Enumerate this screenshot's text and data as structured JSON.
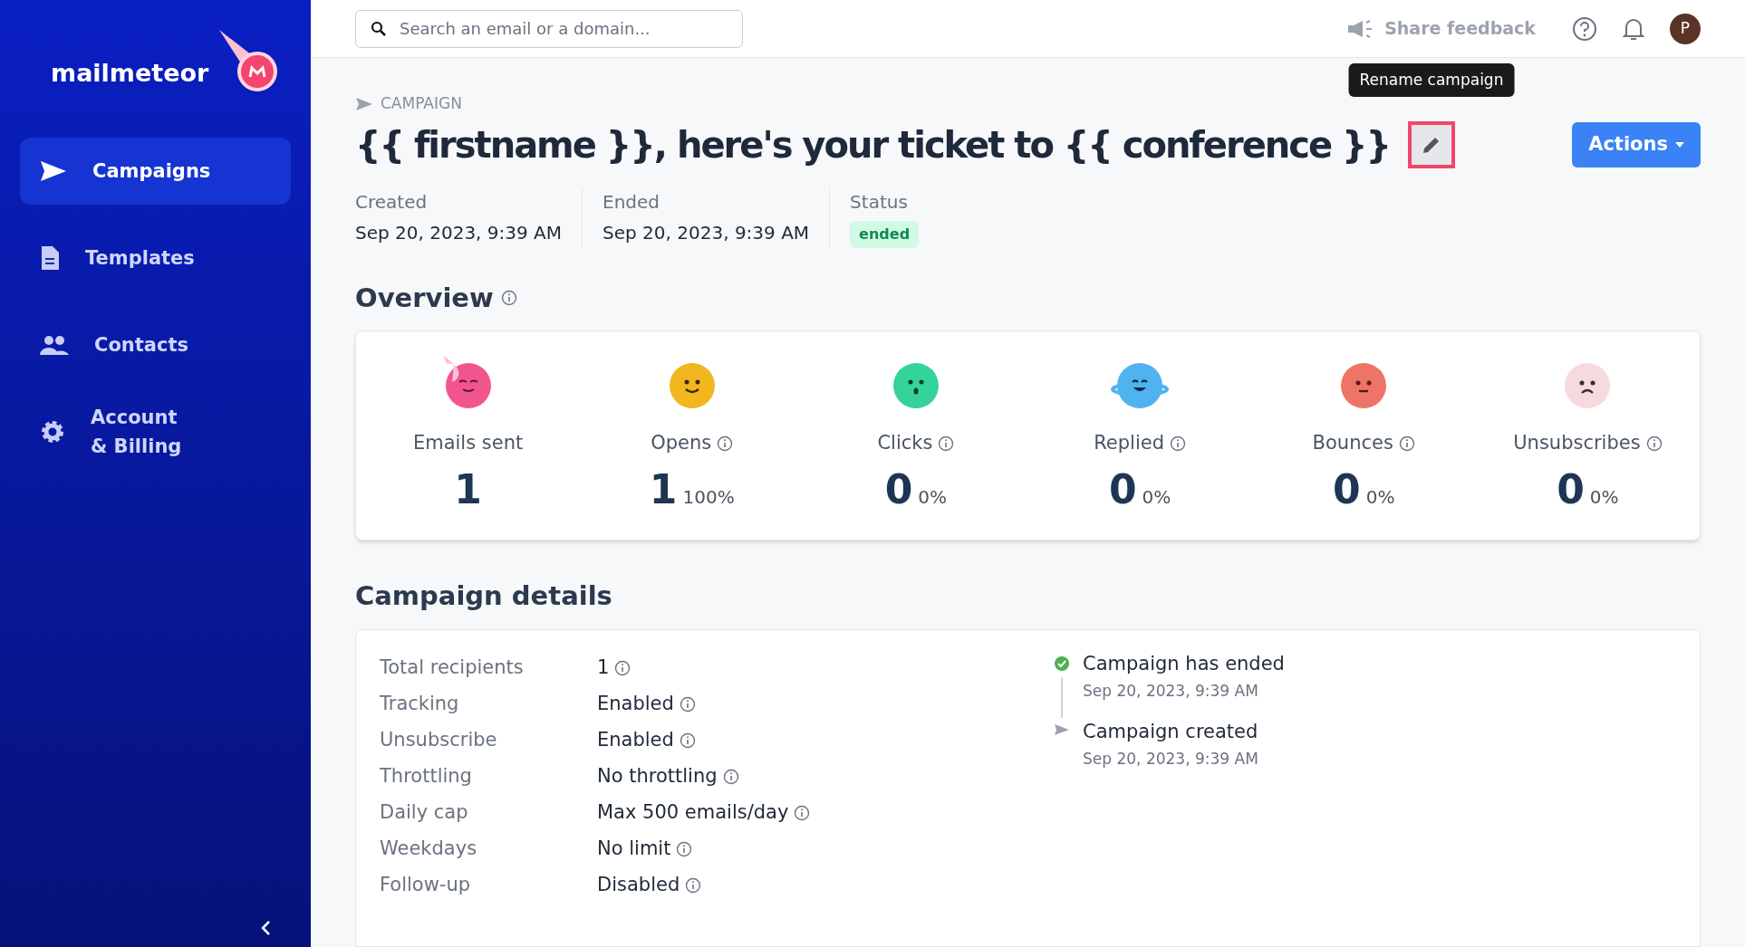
{
  "sidebar": {
    "logo": "mailmeteor",
    "items": [
      {
        "label": "Campaigns",
        "kind": "send",
        "selected": true
      },
      {
        "label": "Templates",
        "kind": "document",
        "selected": false
      },
      {
        "label": "Contacts",
        "kind": "people",
        "selected": false
      },
      {
        "label": "Account\n& Billing",
        "kind": "gear",
        "selected": false
      }
    ]
  },
  "header": {
    "search": {
      "placeholder": "Search an email or a domain..."
    },
    "feedback": "Share feedback",
    "avatar": "P"
  },
  "campaign": {
    "eyebrow": "CAMPAIGN",
    "title": "{{ firstname }}, here's your ticket to {{ conference }}",
    "tooltip": "Rename campaign",
    "actions": "Actions",
    "meta": [
      {
        "label": "Created",
        "value": "Sep 20, 2023, 9:39 AM",
        "kind": "text"
      },
      {
        "label": "Ended",
        "value": "Sep 20, 2023, 9:39 AM",
        "kind": "text"
      },
      {
        "label": "Status",
        "value": "ended",
        "kind": "badge"
      }
    ]
  },
  "overview": {
    "title": "Overview",
    "stats": [
      {
        "label": "Emails sent",
        "value": "1",
        "kind": "meteor",
        "color": "#f2548e",
        "info": false
      },
      {
        "label": "Opens",
        "value": "1",
        "percent": "100%",
        "kind": "smile",
        "color": "#f2b61f",
        "info": true
      },
      {
        "label": "Clicks",
        "value": "0",
        "percent": "0%",
        "kind": "surprised",
        "color": "#34d399",
        "info": true
      },
      {
        "label": "Replied",
        "value": "0",
        "percent": "0%",
        "kind": "planet",
        "color": "#4fb3f0",
        "info": true
      },
      {
        "label": "Bounces",
        "value": "0",
        "percent": "0%",
        "kind": "neutral",
        "color": "#ee7468",
        "info": true
      },
      {
        "label": "Unsubscribes",
        "value": "0",
        "percent": "0%",
        "kind": "sad",
        "color": "#f7dadd",
        "info": true
      }
    ]
  },
  "details": {
    "title": "Campaign details",
    "rows": [
      {
        "label": "Total recipients",
        "value": "1"
      },
      {
        "label": "Tracking",
        "value": "Enabled"
      },
      {
        "label": "Unsubscribe",
        "value": "Enabled"
      },
      {
        "label": "Throttling",
        "value": "No throttling"
      },
      {
        "label": "Daily cap",
        "value": "Max 500 emails/day"
      },
      {
        "label": "Weekdays",
        "value": "No limit"
      },
      {
        "label": "Follow-up",
        "value": "Disabled"
      }
    ],
    "timeline": [
      {
        "title": "Campaign has ended",
        "time": "Sep 20, 2023, 9:39 AM",
        "kind": "done"
      },
      {
        "title": "Campaign created",
        "time": "Sep 20, 2023, 9:39 AM",
        "kind": "sent"
      }
    ]
  }
}
